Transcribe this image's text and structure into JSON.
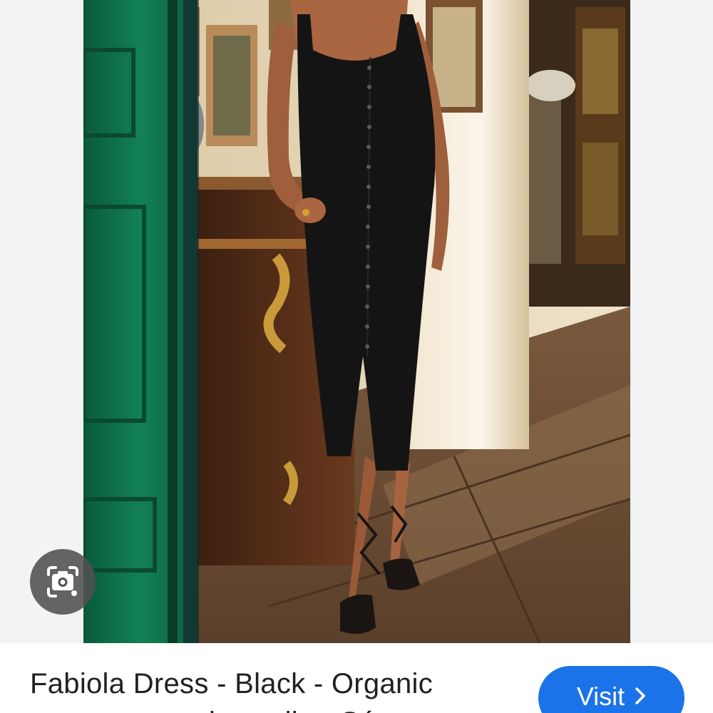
{
  "result": {
    "title": "Fabiola Dress - Black - Organic cotton - organic textile - Sézane"
  },
  "visit_button": {
    "label": "Visit",
    "icon": "chevron-right-icon"
  },
  "lens_button": {
    "icon": "camera-search-icon"
  },
  "colors": {
    "accent": "#1a73e8",
    "door_green": "#0f6e4a",
    "dress_black": "#141414"
  }
}
